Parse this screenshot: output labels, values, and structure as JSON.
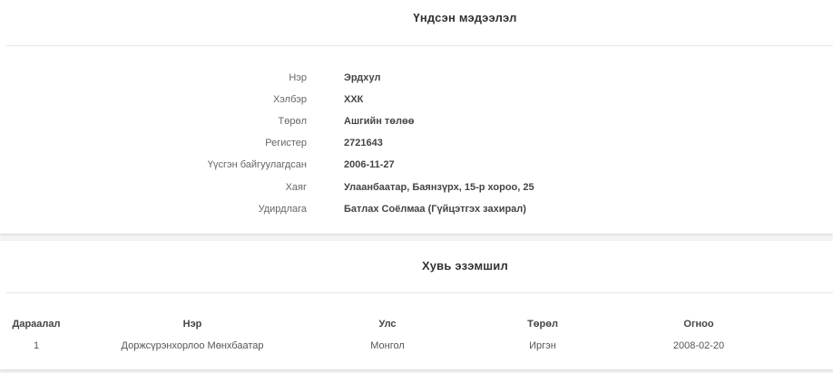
{
  "info_card": {
    "title": "Үндсэн мэдээлэл",
    "rows": [
      {
        "label": "Нэр",
        "value": "Эрдхул"
      },
      {
        "label": "Хэлбэр",
        "value": "ХХК"
      },
      {
        "label": "Төрөл",
        "value": "Ашгийн төлөө"
      },
      {
        "label": "Регистер",
        "value": "2721643"
      },
      {
        "label": "Үүсгэн байгуулагдсан",
        "value": "2006-11-27"
      },
      {
        "label": "Хаяг",
        "value": "Улаанбаатар, Баянзүрх, 15-р хороо, 25"
      },
      {
        "label": "Удирдлага",
        "value": "Батлах Соёлмаа (Гүйцэтгэх захирал)"
      }
    ]
  },
  "ownership_card": {
    "title": "Хувь эзэмшил",
    "columns": [
      "Дараалал",
      "Нэр",
      "Улс",
      "Төрөл",
      "Огноо"
    ],
    "rows": [
      [
        "1",
        "Доржсүрэнхорлоо Мөнхбаатар",
        "Монгол",
        "Иргэн",
        "2008-02-20"
      ]
    ]
  }
}
